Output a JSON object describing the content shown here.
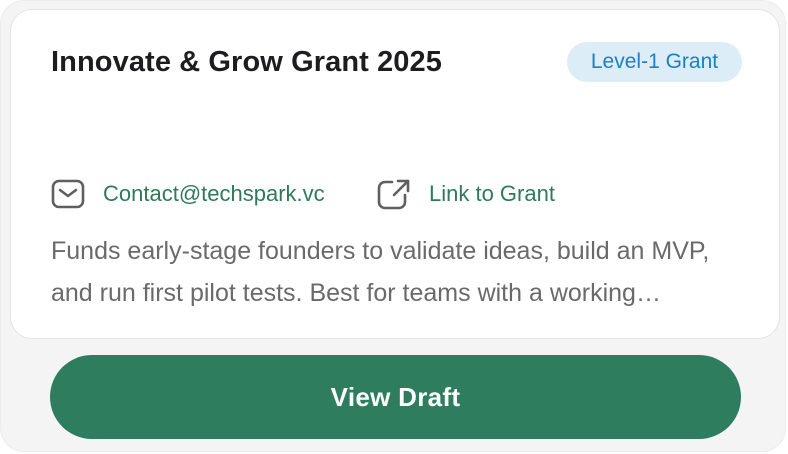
{
  "card": {
    "title": "Innovate & Grow Grant 2025",
    "badge": "Level-1 Grant",
    "contact": {
      "icon": "mail-icon",
      "label": "Contact@techspark.vc"
    },
    "link": {
      "icon": "external-link-icon",
      "label": "Link to Grant"
    },
    "description": "Funds early-stage founders to validate ideas, build an MVP, and run first pilot tests. Best for teams with a working prototype."
  },
  "actions": {
    "view_draft_label": "View Draft"
  },
  "colors": {
    "accent": "#2e7d5f",
    "link_text": "#2e7a5b",
    "badge_bg": "#dcedf8",
    "badge_text": "#1d7fc1",
    "title_text": "#1d1d1f",
    "body_text": "#6a6a6a",
    "icon": "#5f5f5f"
  }
}
